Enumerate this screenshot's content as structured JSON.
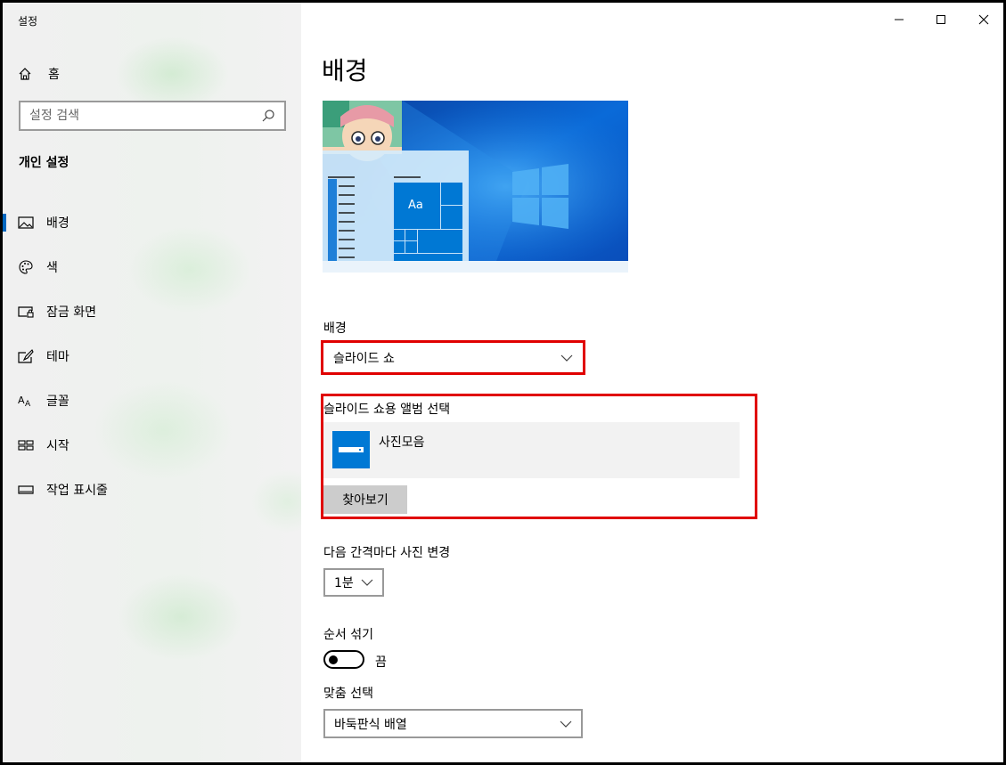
{
  "window": {
    "title": "설정"
  },
  "sidebar": {
    "home_label": "홈",
    "search_placeholder": "설정 검색",
    "section_title": "개인 설정",
    "items": [
      {
        "label": "배경",
        "icon": "picture-icon",
        "active": true
      },
      {
        "label": "색",
        "icon": "palette-icon",
        "active": false
      },
      {
        "label": "잠금 화면",
        "icon": "lock-screen-icon",
        "active": false
      },
      {
        "label": "테마",
        "icon": "theme-brush-icon",
        "active": false
      },
      {
        "label": "글꼴",
        "icon": "font-icon",
        "active": false
      },
      {
        "label": "시작",
        "icon": "start-menu-icon",
        "active": false
      },
      {
        "label": "작업 표시줄",
        "icon": "taskbar-icon",
        "active": false
      }
    ]
  },
  "main": {
    "page_title": "배경",
    "preview": {
      "tile_text": "Aa",
      "accent_color": "#0078d4"
    },
    "background_label": "배경",
    "background_value": "슬라이드 쇼",
    "album_label": "슬라이드 쇼용 앨범 선택",
    "album_name": "사진모음",
    "browse_label": "찾아보기",
    "interval_label": "다음 간격마다 사진 변경",
    "interval_value": "1분",
    "shuffle_label": "순서 섞기",
    "shuffle_state": "끔",
    "fit_label": "맞춤 선택",
    "fit_value": "바둑판식 배열"
  },
  "colors": {
    "highlight_border": "#e00000",
    "accent": "#0078d4"
  }
}
